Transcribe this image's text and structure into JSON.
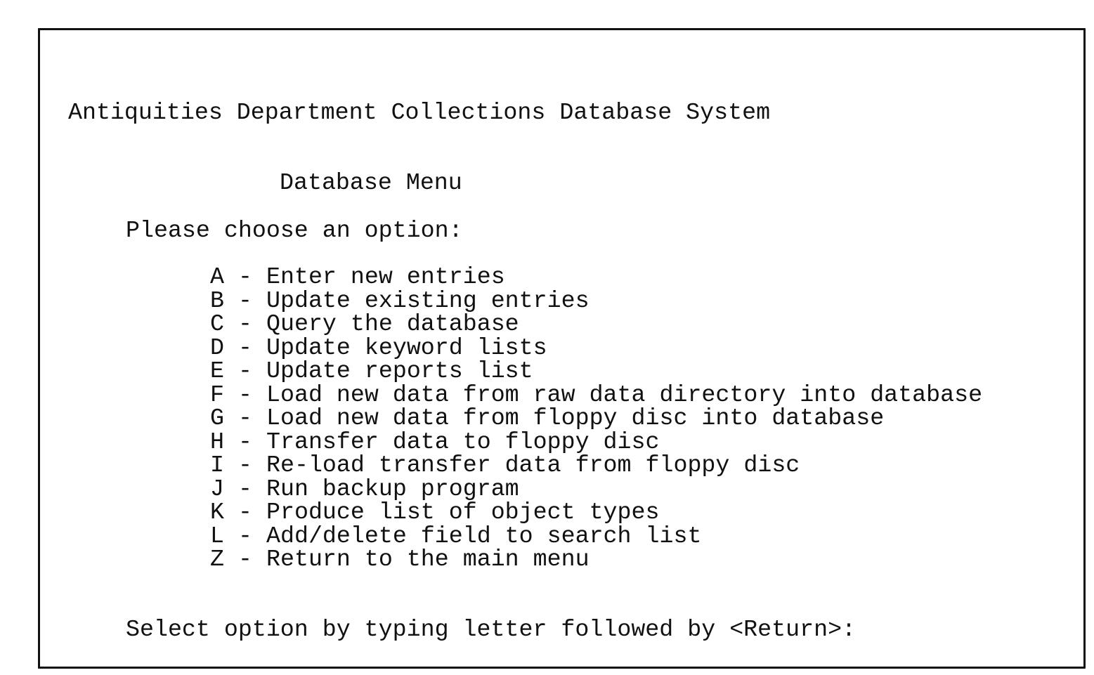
{
  "screen": {
    "title": "Antiquities Department Collections Database System",
    "menu_heading": "Database Menu",
    "choose_prompt": "Please choose an option:",
    "separator": "-",
    "options": [
      {
        "key": "A",
        "label": "Enter new entries"
      },
      {
        "key": "B",
        "label": "Update existing entries"
      },
      {
        "key": "C",
        "label": "Query the database"
      },
      {
        "key": "D",
        "label": "Update keyword lists"
      },
      {
        "key": "E",
        "label": "Update reports list"
      },
      {
        "key": "F",
        "label": "Load new data from raw data directory into database"
      },
      {
        "key": "G",
        "label": "Load new data from floppy disc into database"
      },
      {
        "key": "H",
        "label": "Transfer data to floppy disc"
      },
      {
        "key": "I",
        "label": "Re-load transfer data from floppy disc"
      },
      {
        "key": "J",
        "label": "Run backup program"
      },
      {
        "key": "K",
        "label": "Produce list of object types"
      },
      {
        "key": "L",
        "label": "Add/delete field to search list"
      },
      {
        "key": "Z",
        "label": "Return to the main menu"
      }
    ],
    "select_prompt": "Select option by typing letter followed by <Return>:"
  }
}
